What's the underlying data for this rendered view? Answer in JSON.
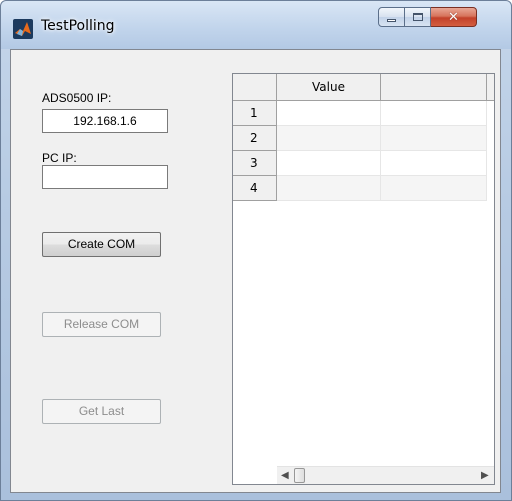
{
  "window": {
    "title": "TestPolling",
    "icon": "matlab-icon",
    "controls": [
      "minimize",
      "maximize",
      "close"
    ]
  },
  "form": {
    "ads_label": "ADS0500 IP:",
    "ads_value": "192.168.1.6",
    "pc_label": "PC IP:",
    "pc_value": ""
  },
  "buttons": {
    "create_com": "Create COM",
    "release_com": "Release COM",
    "get_last": "Get Last"
  },
  "table": {
    "columns": [
      "Value",
      ""
    ],
    "rows": [
      {
        "label": "1",
        "values": [
          "",
          ""
        ]
      },
      {
        "label": "2",
        "values": [
          "",
          ""
        ]
      },
      {
        "label": "3",
        "values": [
          "",
          ""
        ]
      },
      {
        "label": "4",
        "values": [
          "",
          ""
        ]
      }
    ]
  },
  "colors": {
    "close_button": "#c2412a",
    "panel": "#f0f0f0",
    "disabled_text": "#8d8d8d"
  }
}
